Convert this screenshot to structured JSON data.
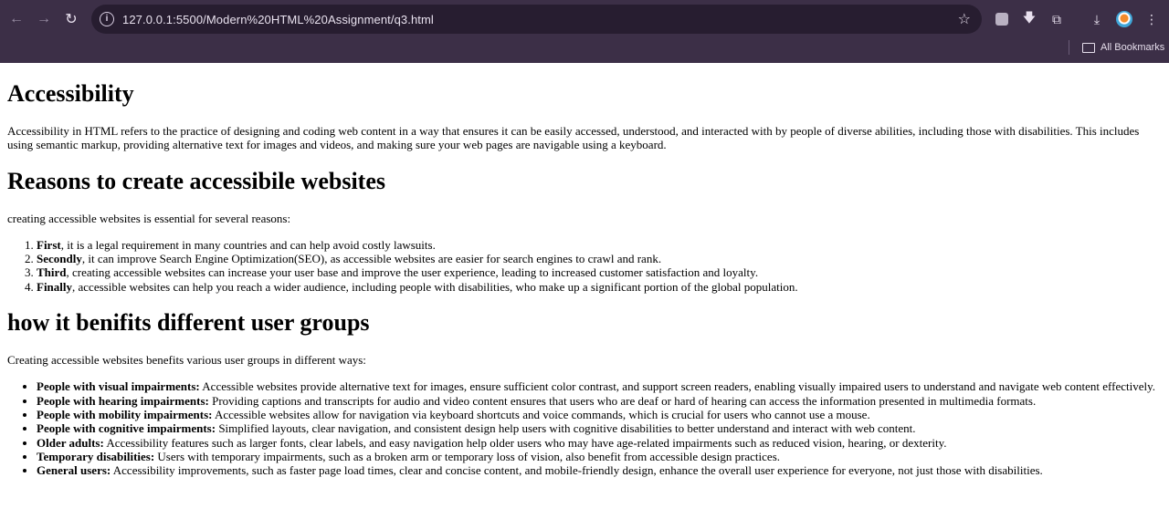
{
  "browser": {
    "url": "127.0.0.1:5500/Modern%20HTML%20Assignment/q3.html",
    "bookmarks_label": "All Bookmarks",
    "icons": [
      "back-icon",
      "forward-icon",
      "reload-icon",
      "site-info-icon",
      "star-icon",
      "extension-icon",
      "download-arrow-icon",
      "puzzle-icon",
      "downloads-icon",
      "profile-avatar",
      "menu-icon",
      "folder-icon"
    ]
  },
  "page": {
    "accessibility": {
      "heading": "Accessibility",
      "text": "Accessibility in HTML refers to the practice of designing and coding web content in a way that ensures it can be easily accessed, understood, and interacted with by people of diverse abilities, including those with disabilities. This includes using semantic markup, providing alternative text for images and videos, and making sure your web pages are navigable using a keyboard."
    },
    "reasons": {
      "heading": "Reasons to create accessibile websites",
      "intro": "creating accessible websites is essential for several reasons:",
      "items": [
        {
          "strong": "First",
          "text": ", it is a legal requirement in many countries and can help avoid costly lawsuits."
        },
        {
          "strong": "Secondly",
          "text": ", it can improve Search Engine Optimization(SEO), as accessible websites are easier for search engines to crawl and rank."
        },
        {
          "strong": "Third",
          "text": ", creating accessible websites can increase your user base and improve the user experience, leading to increased customer satisfaction and loyalty."
        },
        {
          "strong": "Finally",
          "text": ", accessible websites can help you reach a wider audience, including people with disabilities, who make up a significant portion of the global population."
        }
      ]
    },
    "benefits": {
      "heading": "how it benifits different user groups",
      "intro": "Creating accessible websites benefits various user groups in different ways:",
      "items": [
        {
          "strong": "People with visual impairments:",
          "text": " Accessible websites provide alternative text for images, ensure sufficient color contrast, and support screen readers, enabling visually impaired users to understand and navigate web content effectively."
        },
        {
          "strong": "People with hearing impairments:",
          "text": " Providing captions and transcripts for audio and video content ensures that users who are deaf or hard of hearing can access the information presented in multimedia formats."
        },
        {
          "strong": "People with mobility impairments:",
          "text": " Accessible websites allow for navigation via keyboard shortcuts and voice commands, which is crucial for users who cannot use a mouse."
        },
        {
          "strong": "People with cognitive impairments:",
          "text": " Simplified layouts, clear navigation, and consistent design help users with cognitive disabilities to better understand and interact with web content."
        },
        {
          "strong": "Older adults:",
          "text": " Accessibility features such as larger fonts, clear labels, and easy navigation help older users who may have age-related impairments such as reduced vision, hearing, or dexterity."
        },
        {
          "strong": "Temporary disabilities:",
          "text": " Users with temporary impairments, such as a broken arm or temporary loss of vision, also benefit from accessible design practices."
        },
        {
          "strong": "General users:",
          "text": " Accessibility improvements, such as faster page load times, clear and concise content, and mobile-friendly design, enhance the overall user experience for everyone, not just those with disabilities."
        }
      ]
    }
  },
  "colors": {
    "chrome_bg": "#3c2f47",
    "omnibox_bg": "#271d30",
    "page_bg": "#ffffff"
  }
}
